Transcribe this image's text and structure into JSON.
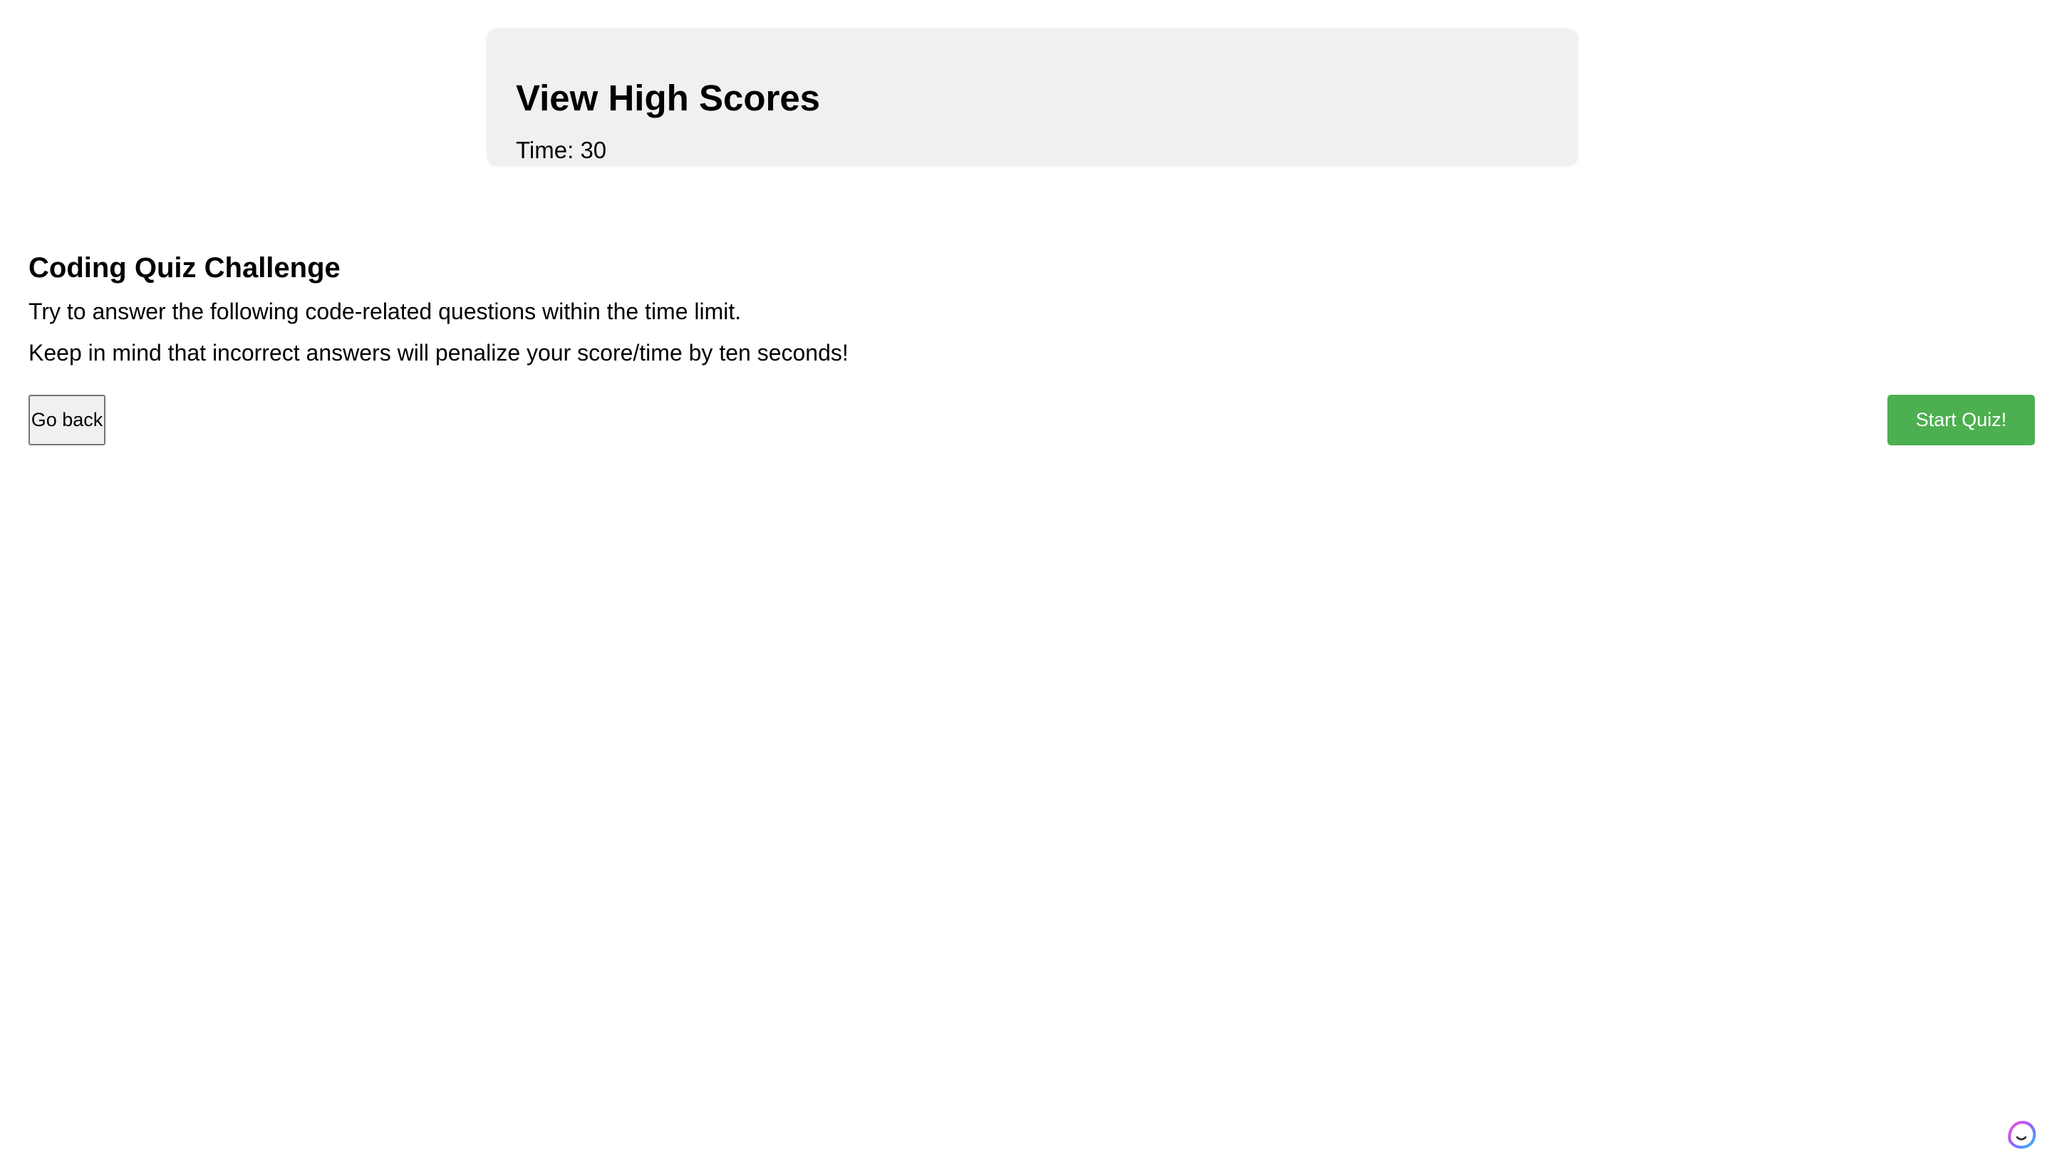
{
  "header": {
    "title": "View High Scores",
    "time_label": "Time: 30"
  },
  "quiz": {
    "title": "Coding Quiz Challenge",
    "instructions": [
      "Try to answer the following code-related questions within the time limit.",
      "Keep in mind that incorrect answers will penalize your score/time by ten seconds!"
    ]
  },
  "buttons": {
    "go_back_label": "Go back",
    "start_label": "Start Quiz!"
  },
  "icons": {
    "assistant": "assistant-face-icon"
  },
  "colors": {
    "header_bg": "#f0f0f0",
    "start_button_bg": "#4caf50",
    "start_button_text": "#ffffff"
  }
}
